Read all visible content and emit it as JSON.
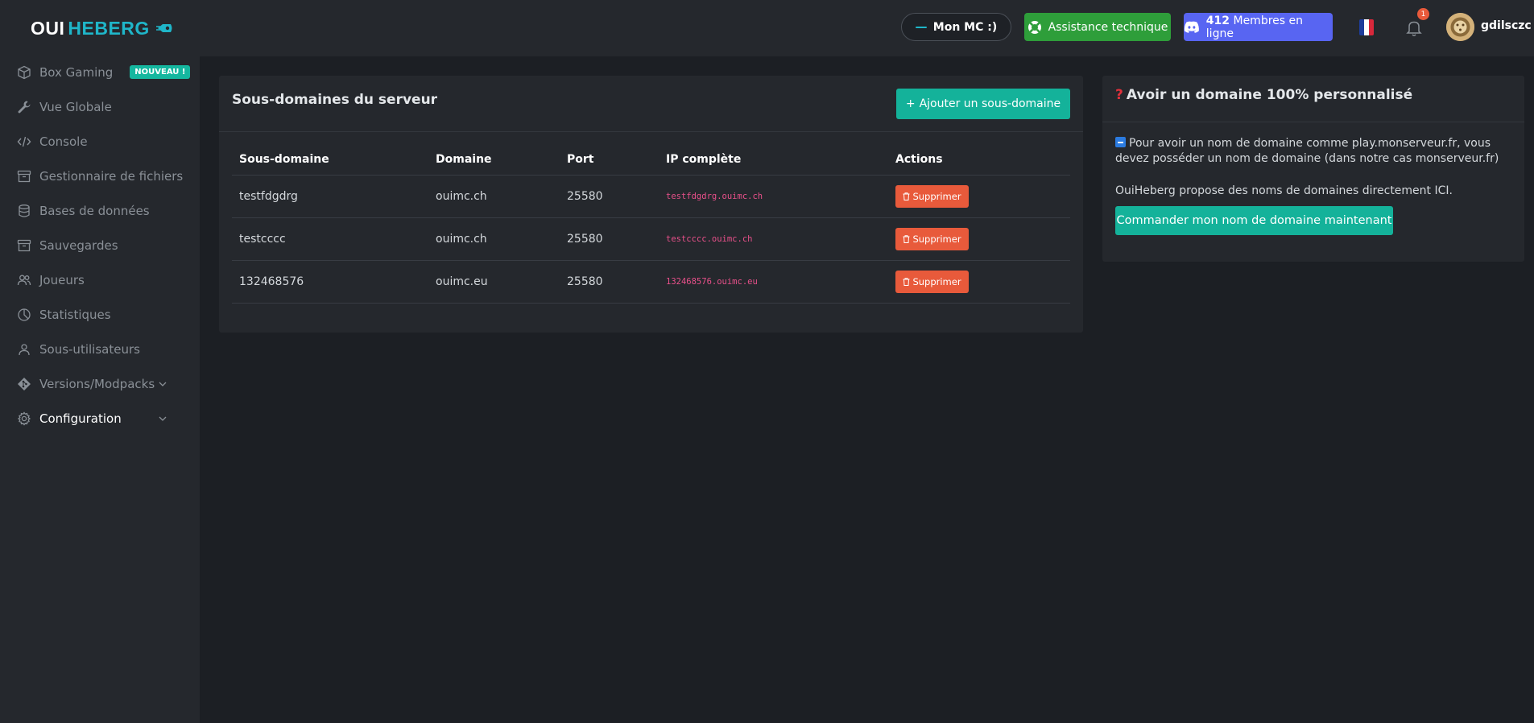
{
  "brand": {
    "part1": "OUI",
    "part2": "HEBERG"
  },
  "sidebar": {
    "items": [
      {
        "label": "Box Gaming",
        "icon": "box-icon",
        "badge": "NOUVEAU !"
      },
      {
        "label": "Vue Globale",
        "icon": "wrench-icon"
      },
      {
        "label": "Console",
        "icon": "code-icon"
      },
      {
        "label": "Gestionnaire de fichiers",
        "icon": "archive-icon"
      },
      {
        "label": "Bases de données",
        "icon": "database-icon"
      },
      {
        "label": "Sauvegardes",
        "icon": "archive-icon"
      },
      {
        "label": "Joueurs",
        "icon": "users-icon"
      },
      {
        "label": "Statistiques",
        "icon": "pie-chart-icon"
      },
      {
        "label": "Sous-utilisateurs",
        "icon": "user-icon"
      },
      {
        "label": "Versions/Modpacks",
        "icon": "git-icon"
      },
      {
        "label": "Configuration",
        "icon": "gear-icon"
      }
    ]
  },
  "topbar": {
    "server_name": "Mon MC :)",
    "support_label": "Assistance technique",
    "discord_count": "412",
    "discord_label": "Membres en ligne",
    "notification_count": "1",
    "username": "gdilsczc"
  },
  "main": {
    "title": "Sous-domaines du serveur",
    "add_button": "Ajouter un sous-domaine",
    "columns": [
      "Sous-domaine",
      "Domaine",
      "Port",
      "IP complète",
      "Actions"
    ],
    "rows": [
      {
        "subdomain": "testfdgdrg",
        "domain": "ouimc.ch",
        "port": "25580",
        "ip": "testfdgdrg.ouimc.ch",
        "action": "Supprimer"
      },
      {
        "subdomain": "testcccc",
        "domain": "ouimc.ch",
        "port": "25580",
        "ip": "testcccc.ouimc.ch",
        "action": "Supprimer"
      },
      {
        "subdomain": "132468576",
        "domain": "ouimc.eu",
        "port": "25580",
        "ip": "132468576.ouimc.eu",
        "action": "Supprimer"
      }
    ]
  },
  "side": {
    "title": "Avoir un domaine 100% personnalisé",
    "paragraph1": "Pour avoir un nom de domaine comme play.monserveur.fr, vous devez posséder un nom de domaine (dans notre cas monserveur.fr)",
    "paragraph2": "OuiHeberg propose des noms de domaines directement ICI.",
    "order_button": "Commander mon nom de domaine maintenant"
  },
  "colors": {
    "accent": "#14b29a",
    "danger": "#e85a3b",
    "support": "#2e9e3a",
    "discord": "#5865f2",
    "ip_text": "#e8508a"
  }
}
